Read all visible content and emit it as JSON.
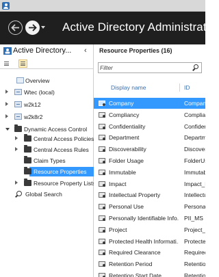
{
  "header": {
    "title": "Active Directory Administrative"
  },
  "left_pane": {
    "title": "Active Directory...",
    "tree": [
      {
        "label": "Overview",
        "level": 0,
        "expander": "none",
        "icon": "overview-icon"
      },
      {
        "label": "Wtec (local)",
        "level": 0,
        "expander": "closed",
        "icon": "server-icon"
      },
      {
        "label": "w2k12",
        "level": 0,
        "expander": "closed",
        "icon": "server-icon"
      },
      {
        "label": "w2k8r2",
        "level": 0,
        "expander": "closed",
        "icon": "server-icon"
      },
      {
        "label": "Dynamic Access Control",
        "level": 0,
        "expander": "open",
        "icon": "folder-icon"
      },
      {
        "label": "Central Access Policies",
        "level": 1,
        "expander": "closed",
        "icon": "folder-icon"
      },
      {
        "label": "Central Access Rules",
        "level": 1,
        "expander": "closed",
        "icon": "folder-icon"
      },
      {
        "label": "Claim Types",
        "level": 1,
        "expander": "none",
        "icon": "folder-icon"
      },
      {
        "label": "Resource Properties",
        "level": 1,
        "expander": "none",
        "icon": "folder-icon",
        "selected": true
      },
      {
        "label": "Resource Property Lists",
        "level": 1,
        "expander": "closed",
        "icon": "folder-icon"
      },
      {
        "label": "Global Search",
        "level": 0,
        "expander": "none",
        "icon": "search-icon"
      }
    ]
  },
  "right_pane": {
    "title": "Resource Properties  (16)",
    "filter_placeholder": "Filter",
    "columns": {
      "name": "Display name",
      "id": "ID"
    },
    "rows": [
      {
        "name": "Company",
        "id": "Company",
        "selected": true
      },
      {
        "name": "Compliancy",
        "id": "Complia"
      },
      {
        "name": "Confidentiality",
        "id": "Confiden"
      },
      {
        "name": "Department",
        "id": "Departm"
      },
      {
        "name": "Discoverability",
        "id": "Discover"
      },
      {
        "name": "Folder Usage",
        "id": "FolderUs"
      },
      {
        "name": "Immutable",
        "id": "Immutab"
      },
      {
        "name": "Impact",
        "id": "Impact_M"
      },
      {
        "name": "Intellectual Property",
        "id": "Intellectu"
      },
      {
        "name": "Personal Use",
        "id": "Personal"
      },
      {
        "name": "Personally Identifiable Info...",
        "id": "PII_MS"
      },
      {
        "name": "Project",
        "id": "Project_M"
      },
      {
        "name": "Protected Health Informati...",
        "id": "Protected"
      },
      {
        "name": "Required Clearance",
        "id": "Required"
      },
      {
        "name": "Retention Period",
        "id": "Retention"
      },
      {
        "name": "Retention Start Date",
        "id": "Retention"
      }
    ]
  },
  "colors": {
    "header_bg": "#1f1f1f",
    "selection": "#3399ff",
    "column_header_text": "#3a6fb0"
  }
}
